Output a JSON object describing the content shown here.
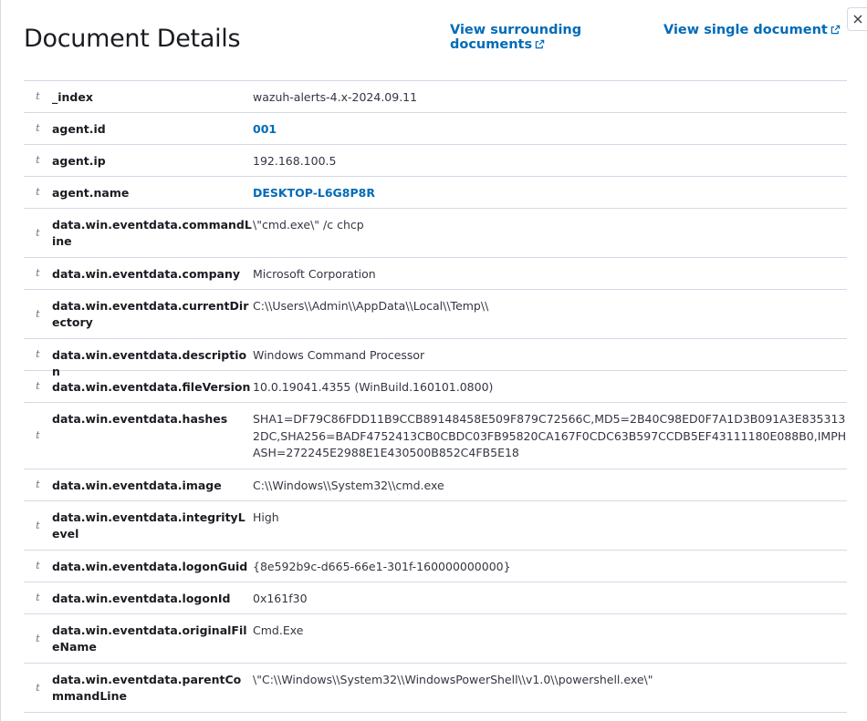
{
  "header": {
    "title": "Document Details",
    "link_surrounding": "View surrounding documents",
    "link_single": "View single document",
    "close_icon": "close-icon",
    "external_icon": "external-link-icon",
    "link_color": "#006bb8"
  },
  "rows": [
    {
      "type": "t",
      "field": "_index",
      "value": "wazuh-alerts-4.x-2024.09.11",
      "link": false
    },
    {
      "type": "t",
      "field": "agent.id",
      "value": "001",
      "link": true
    },
    {
      "type": "t",
      "field": "agent.ip",
      "value": "192.168.100.5",
      "link": false
    },
    {
      "type": "t",
      "field": "agent.name",
      "value": "DESKTOP-L6G8P8R",
      "link": true
    },
    {
      "type": "t",
      "field": "data.win.eventdata.commandLine",
      "value": "\\\"cmd.exe\\\" /c chcp",
      "link": false
    },
    {
      "type": "t",
      "field": "data.win.eventdata.company",
      "value": "Microsoft Corporation",
      "link": false
    },
    {
      "type": "t",
      "field": "data.win.eventdata.currentDirectory",
      "value": "C:\\\\Users\\\\Admin\\\\AppData\\\\Local\\\\Temp\\\\",
      "link": false
    },
    {
      "type": "t",
      "field": "data.win.eventdata.description",
      "value": "Windows Command Processor",
      "link": false
    },
    {
      "type": "t",
      "field": "data.win.eventdata.fileVersion",
      "value": "10.0.19041.4355 (WinBuild.160101.0800)",
      "link": false
    },
    {
      "type": "t",
      "field": "data.win.eventdata.hashes",
      "value": "SHA1=DF79C86FDD11B9CCB89148458E509F879C72566C,MD5=2B40C98ED0F7A1D3B091A3E8353132DC,SHA256=BADF4752413CB0CBDC03FB95820CA167F0CDC63B597CCDB5EF43111180E088B0,IMPHASH=272245E2988E1E430500B852C4FB5E18",
      "link": false
    },
    {
      "type": "t",
      "field": "data.win.eventdata.image",
      "value": "C:\\\\Windows\\\\System32\\\\cmd.exe",
      "link": false
    },
    {
      "type": "t",
      "field": "data.win.eventdata.integrityLevel",
      "value": "High",
      "link": false
    },
    {
      "type": "t",
      "field": "data.win.eventdata.logonGuid",
      "value": "{8e592b9c-d665-66e1-301f-160000000000}",
      "link": false
    },
    {
      "type": "t",
      "field": "data.win.eventdata.logonId",
      "value": "0x161f30",
      "link": false
    },
    {
      "type": "t",
      "field": "data.win.eventdata.originalFileName",
      "value": "Cmd.Exe",
      "link": false
    },
    {
      "type": "t",
      "field": "data.win.eventdata.parentCommandLine",
      "value": "\\\"C:\\\\Windows\\\\System32\\\\WindowsPowerShell\\\\v1.0\\\\powershell.exe\\\"",
      "link": false
    }
  ]
}
